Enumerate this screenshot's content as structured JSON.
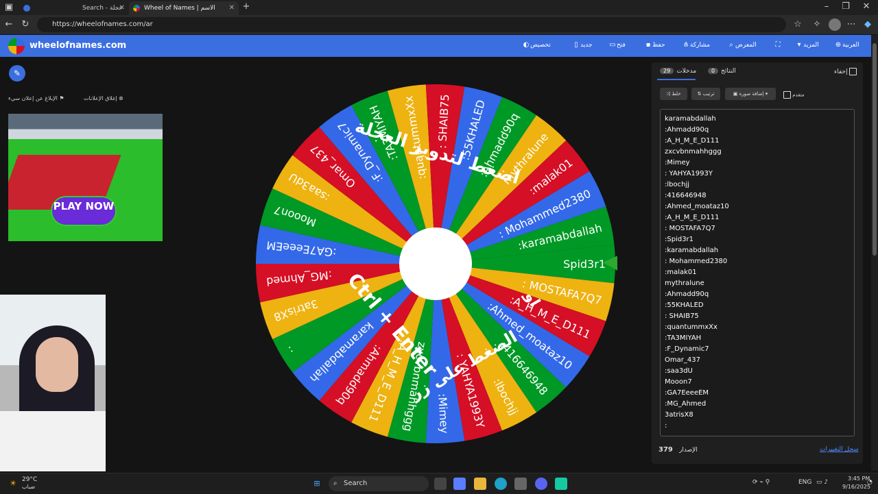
{
  "browser": {
    "tabs": [
      {
        "label": "Search - عجلة الحظ"
      },
      {
        "label": "Wheel of Names | الاسم العشوائي"
      }
    ],
    "new_tab": "+",
    "url": "https://wheelofnames.com/ar"
  },
  "app": {
    "logo_text": "wheelofnames.com",
    "menu": {
      "customize": "تخصيص",
      "new": "جديد",
      "open": "فتح",
      "save": "حفظ",
      "share": "مشاركة",
      "gallery": "المعرض",
      "more": "المزيد",
      "language": "العربية"
    }
  },
  "ads": {
    "report": "الإبلاغ عن إعلان سيء",
    "close": "إغلاق الإعلانات",
    "play_now": "PLAY NOW"
  },
  "wheel": {
    "center_text": "اضغط لتدوير العجلة",
    "shortcut_text": "Ctrl + Enter",
    "shortcut_caption": "الضغط على زر",
    "shortcut_caption2": "او",
    "segments": [
      "Spid3r1",
      ": MOSTAFA7Q7",
      ":A_H_M_E_D111",
      ":Ahmed_moataz10",
      ":416646948",
      ":lbochjj",
      ": YAHYA1993Y",
      ":Mimey",
      "zxcvbnmahhggg",
      ":A_H_M_E_D111",
      ":Ahmadd90q",
      "karamabdallah",
      ":",
      "3atrisX8",
      ":MG_Ahmed",
      ":GA7EeeeEM",
      "Mooon7",
      ":saa3dU",
      "Omar_437",
      ":F_Dynamic7",
      ":TA3MIYAH",
      ":quantummxXx",
      ": SHAIB75",
      ":55KHALED",
      ":Ahmadd90q",
      "mythralune",
      ":malak01",
      ": Mohammed2380",
      ":karamabdallah"
    ],
    "colors": [
      "#009925",
      "#eeb211",
      "#d50f25",
      "#3369e8"
    ]
  },
  "panel": {
    "hide_label": "إخفاء",
    "tab_entries": "مدخلات",
    "entries_count": "29",
    "tab_results": "النتائج",
    "results_count": "0",
    "shuffle": "خلط",
    "sort": "ترتيب",
    "add_image": "إضافة صورة",
    "advanced": "متقدم",
    "entries": [
      "karamabdallah",
      ":Ahmadd90q",
      ":A_H_M_E_D111",
      "zxcvbnmahhggg",
      ":Mimey",
      ": YAHYA1993Y",
      ":lbochjj",
      ":416646948",
      ":Ahmed_moataz10",
      ":A_H_M_E_D111",
      ": MOSTAFA7Q7",
      ":Spid3r1",
      ":karamabdallah",
      ": Mohammed2380",
      ":malak01",
      "mythralune",
      ":Ahmadd90q",
      ":55KHALED",
      ": SHAIB75",
      ":quantummxXx",
      ":TA3MIYAH",
      ":F_Dynamic7",
      "Omar_437",
      ":saa3dU",
      "Mooon7",
      ":GA7EeeeEM",
      ":MG_Ahmed",
      "3atrisX8",
      ":"
    ],
    "edition_label": "الإصدار",
    "edition_value": "379",
    "changelog": "سجل التغييرات"
  },
  "taskbar": {
    "weather_temp": "29°C",
    "weather_desc": "ضباب",
    "search": "Search",
    "lang": "ENG",
    "time": "3:45 PM",
    "date": "9/16/2025"
  }
}
